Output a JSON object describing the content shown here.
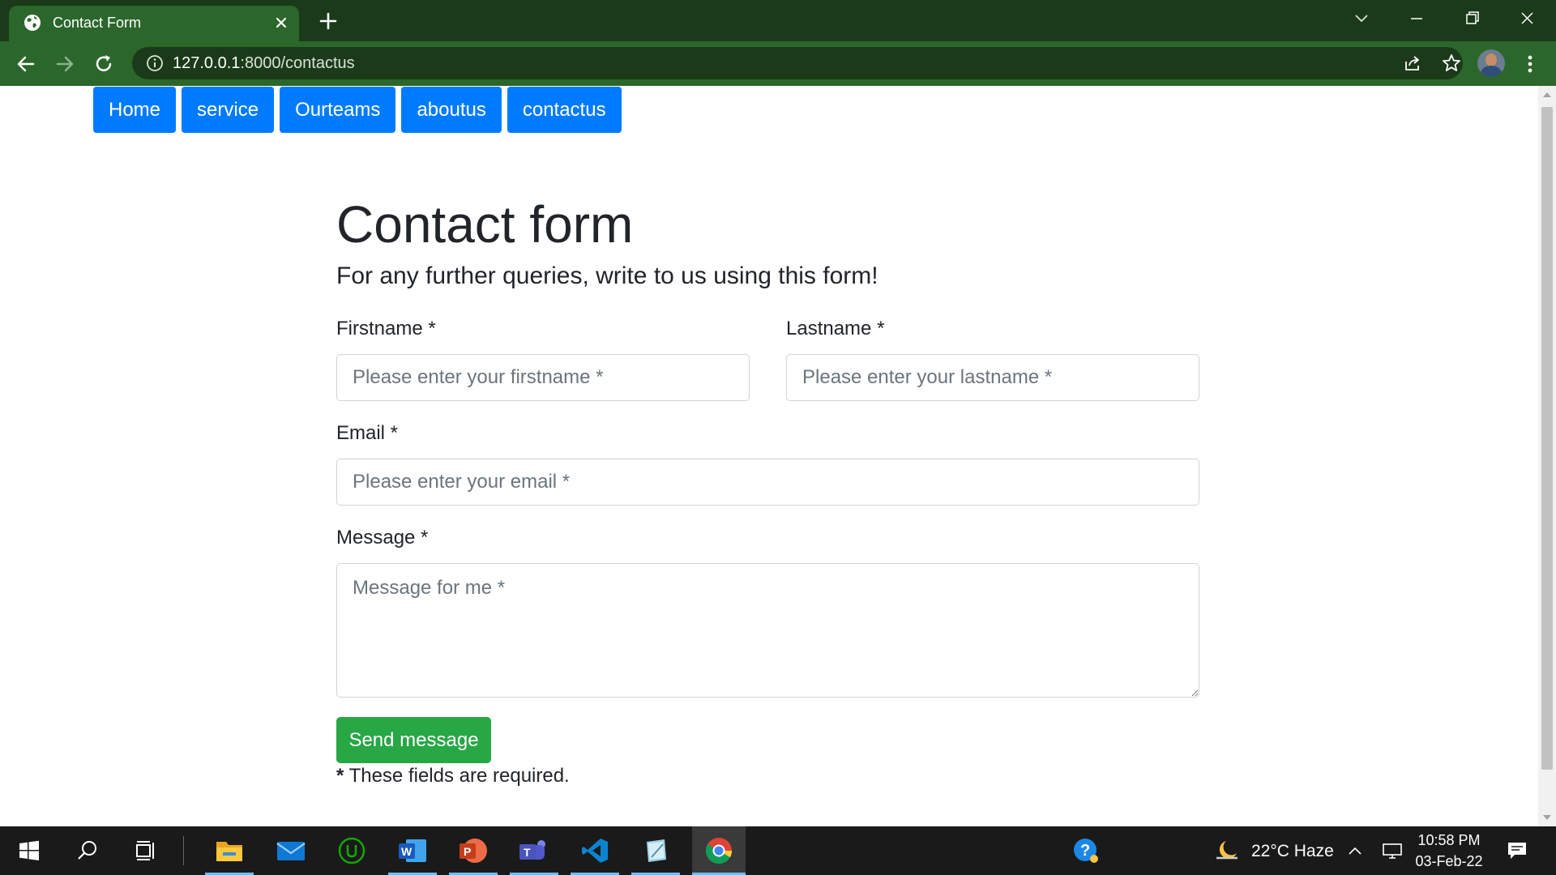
{
  "browser": {
    "tab_title": "Contact Form",
    "url_host": "127.0.0.1",
    "url_rest": ":8000/contactus"
  },
  "nav": {
    "items": [
      {
        "label": "Home"
      },
      {
        "label": "service"
      },
      {
        "label": "Ourteams"
      },
      {
        "label": "aboutus"
      },
      {
        "label": "contactus"
      }
    ]
  },
  "form": {
    "title": "Contact form",
    "lead": "For any further queries, write to us using this form!",
    "firstname_label": "Firstname *",
    "firstname_placeholder": "Please enter your firstname *",
    "lastname_label": "Lastname *",
    "lastname_placeholder": "Please enter your lastname *",
    "email_label": "Email *",
    "email_placeholder": "Please enter your email *",
    "message_label": "Message *",
    "message_placeholder": "Message for me *",
    "submit_label": "Send message",
    "required_star": "*",
    "required_text": " These fields are required."
  },
  "colors": {
    "nav_button": "#007bff",
    "submit_button": "#28a745",
    "browser_theme": "#2b662a"
  },
  "taskbar": {
    "weather": "22°C  Haze",
    "time": "10:58 PM",
    "date": "03-Feb-22",
    "apps": [
      "windows-start-icon",
      "search-icon",
      "task-view-icon",
      "file-explorer-icon",
      "mail-icon",
      "upwork-icon",
      "word-icon",
      "powerpoint-icon",
      "teams-icon",
      "vscode-icon",
      "notepad-icon",
      "chrome-icon"
    ]
  }
}
